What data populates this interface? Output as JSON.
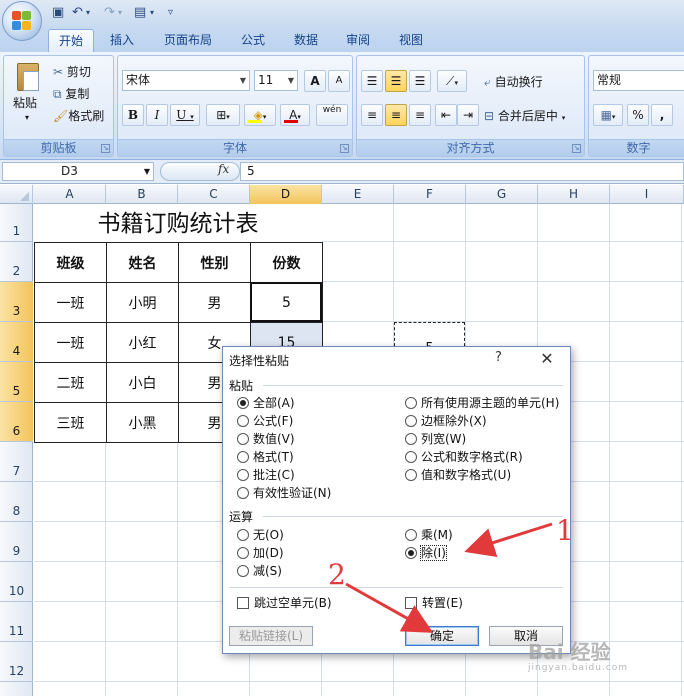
{
  "ribbon": {
    "tabs": [
      "开始",
      "插入",
      "页面布局",
      "公式",
      "数据",
      "审阅",
      "视图"
    ],
    "clipboard": {
      "paste": "粘贴",
      "cut": "剪切",
      "copy": "复制",
      "format_painter": "格式刷",
      "label": "剪贴板"
    },
    "font": {
      "name": "宋体",
      "size": "11",
      "label": "字体",
      "bold": "B",
      "italic": "I",
      "underline": "U",
      "grow": "A",
      "shrink": "A",
      "phonetic": "wén",
      "font_color_letter": "A"
    },
    "alignment": {
      "wrap": "自动换行",
      "merge": "合并后居中",
      "label": "对齐方式"
    },
    "number": {
      "format": "常规",
      "percent": "%",
      "comma": ",",
      "label": "数字"
    }
  },
  "formula_bar": {
    "name_box": "D3",
    "fx": "fx",
    "value": "5"
  },
  "sheet": {
    "columns": [
      "A",
      "B",
      "C",
      "D",
      "E",
      "F",
      "G",
      "H",
      "I"
    ],
    "rows": [
      "1",
      "2",
      "3",
      "4",
      "5",
      "6",
      "7",
      "8",
      "9",
      "10",
      "11",
      "12"
    ],
    "title": "书籍订购统计表",
    "headers": [
      "班级",
      "姓名",
      "性别",
      "份数"
    ],
    "data_rows": [
      [
        "一班",
        "小明",
        "男",
        "5"
      ],
      [
        "一班",
        "小红",
        "女",
        "15"
      ],
      [
        "二班",
        "小白",
        "男",
        ""
      ],
      [
        "三班",
        "小黑",
        "男",
        ""
      ]
    ],
    "copied_value": "5"
  },
  "dialog": {
    "title": "选择性粘贴",
    "help": "?",
    "close": "✕",
    "paste_section": "粘贴",
    "paste_left": [
      "全部(A)",
      "公式(F)",
      "数值(V)",
      "格式(T)",
      "批注(C)",
      "有效性验证(N)"
    ],
    "paste_right": [
      "所有使用源主题的单元(H)",
      "边框除外(X)",
      "列宽(W)",
      "公式和数字格式(R)",
      "值和数字格式(U)"
    ],
    "op_section": "运算",
    "op_left": [
      "无(O)",
      "加(D)",
      "减(S)"
    ],
    "op_right": [
      "乘(M)",
      "除(I)"
    ],
    "skip_blanks": "跳过空单元(B)",
    "transpose": "转置(E)",
    "paste_link": "粘贴链接(L)",
    "ok": "确定",
    "cancel": "取消"
  },
  "annotations": {
    "step1": "1",
    "step2": "2",
    "color": "#e23a3a"
  },
  "watermark": {
    "text": "Bai 经验",
    "sub": "jingyan.baidu.com"
  }
}
